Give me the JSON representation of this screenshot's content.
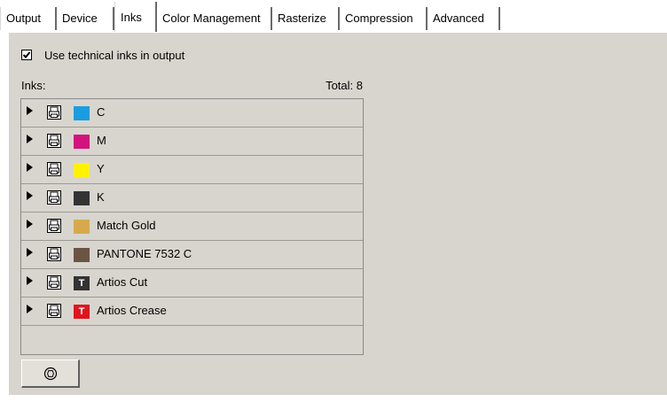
{
  "tabs": [
    {
      "label": "Output"
    },
    {
      "label": "Device"
    },
    {
      "label": "Inks"
    },
    {
      "label": "Color Management"
    },
    {
      "label": "Rasterize"
    },
    {
      "label": "Compression"
    },
    {
      "label": "Advanced"
    }
  ],
  "active_tab": "Inks",
  "options": {
    "technical_inks_label": "Use technical inks in output",
    "technical_inks_checked": true
  },
  "inks_header": {
    "label": "Inks:",
    "total": "Total: 8"
  },
  "inks": [
    {
      "name": "C",
      "color": "#1a9de0",
      "technical": false
    },
    {
      "name": "M",
      "color": "#d4127e",
      "technical": false
    },
    {
      "name": "Y",
      "color": "#fff200",
      "technical": false
    },
    {
      "name": "K",
      "color": "#333333",
      "technical": false
    },
    {
      "name": "Match Gold",
      "color": "#d6aa4c",
      "technical": false
    },
    {
      "name": "PANTONE 7532 C",
      "color": "#6b5444",
      "technical": false
    },
    {
      "name": "Artios Cut",
      "color": "#333333",
      "technical": true,
      "glyph": "T"
    },
    {
      "name": "Artios Crease",
      "color": "#e0141e",
      "technical": true,
      "glyph": "T"
    }
  ],
  "icons": {
    "expand": "triangle-right-icon",
    "printer": "printer-icon",
    "bottom_button": "stop-icon"
  }
}
